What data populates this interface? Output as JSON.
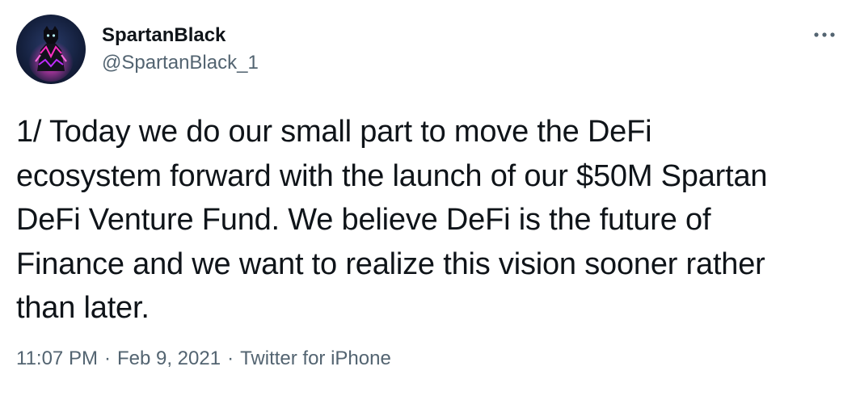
{
  "author": {
    "display_name": "SpartanBlack",
    "handle": "@SpartanBlack_1",
    "avatar_icon": "panther-warrior-avatar"
  },
  "more_icon": "more-dots-icon",
  "tweet": {
    "text": "1/ Today we do our small part to move the DeFi\necosystem forward with the launch of our $50M Spartan\nDeFi Venture Fund. We believe DeFi is the future of\nFinance and we want to realize this vision sooner rather\nthan later."
  },
  "meta": {
    "time": "11:07 PM",
    "separator_1": "·",
    "date": "Feb 9, 2021",
    "separator_2": "·",
    "source": "Twitter for iPhone"
  },
  "colors": {
    "text_primary": "#0f1419",
    "text_secondary": "#536471",
    "background": "#ffffff"
  }
}
